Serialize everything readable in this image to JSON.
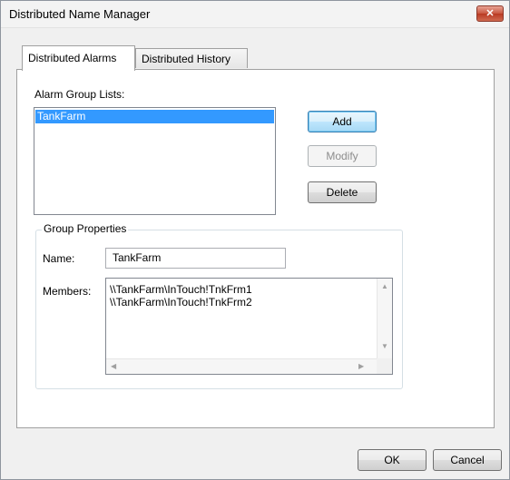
{
  "window": {
    "title": "Distributed Name Manager",
    "close_glyph": "✕"
  },
  "tabs": [
    {
      "label": "Distributed Alarms",
      "active": true
    },
    {
      "label": "Distributed History",
      "active": false
    }
  ],
  "alarm_groups": {
    "label": "Alarm Group Lists:",
    "items": [
      {
        "text": "TankFarm",
        "selected": true
      }
    ]
  },
  "buttons": {
    "add": "Add",
    "modify": "Modify",
    "delete": "Delete",
    "ok": "OK",
    "cancel": "Cancel"
  },
  "group_properties": {
    "legend": "Group Properties",
    "name_label": "Name:",
    "name_value": "TankFarm",
    "members_label": "Members:",
    "members": [
      "\\\\TankFarm\\InTouch!TnkFrm1",
      "\\\\TankFarm\\InTouch!TnkFrm2"
    ]
  },
  "colors": {
    "selection": "#3399ff",
    "close_button": "#c8563f",
    "default_button_border": "#3c7fb1"
  }
}
